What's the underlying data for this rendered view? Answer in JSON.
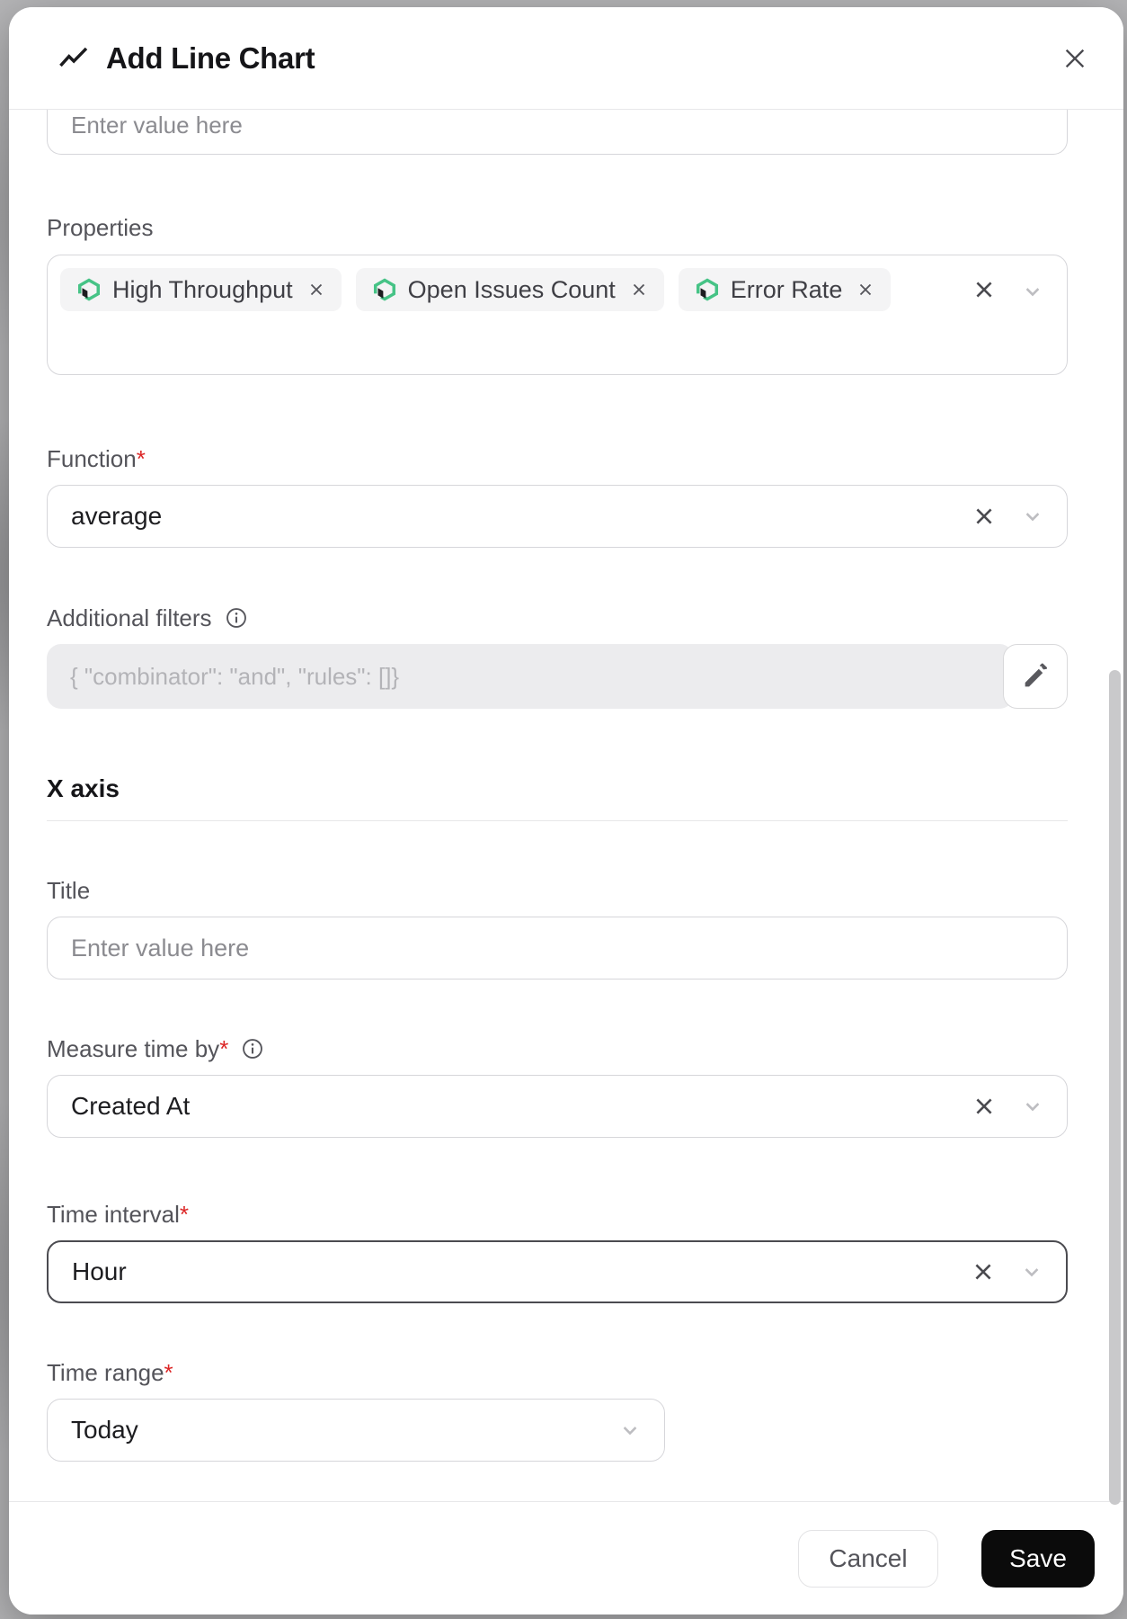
{
  "dialog": {
    "title": "Add Line Chart"
  },
  "ui": {
    "required_mark": "*"
  },
  "fields": {
    "value_input": {
      "placeholder": "Enter value here"
    },
    "properties": {
      "label": "Properties",
      "chips": [
        {
          "label": "High Throughput"
        },
        {
          "label": "Open Issues Count"
        },
        {
          "label": "Error Rate"
        }
      ]
    },
    "function": {
      "label": "Function",
      "value": "average"
    },
    "additional_filters": {
      "label": "Additional filters",
      "value": "{  \"combinator\": \"and\",  \"rules\": []}"
    },
    "x_axis": {
      "section_title": "X axis"
    },
    "title": {
      "label": "Title",
      "placeholder": "Enter value here"
    },
    "measure_time_by": {
      "label": "Measure time by",
      "value": "Created At"
    },
    "time_interval": {
      "label": "Time interval",
      "value": "Hour"
    },
    "time_range": {
      "label": "Time range",
      "value": "Today"
    }
  },
  "footer": {
    "cancel": "Cancel",
    "save": "Save"
  },
  "colors": {
    "brand_green": "#46C386",
    "required_red": "#DC2626",
    "save_bg": "#0B0B0B",
    "focus_border": "#4B4B50"
  }
}
